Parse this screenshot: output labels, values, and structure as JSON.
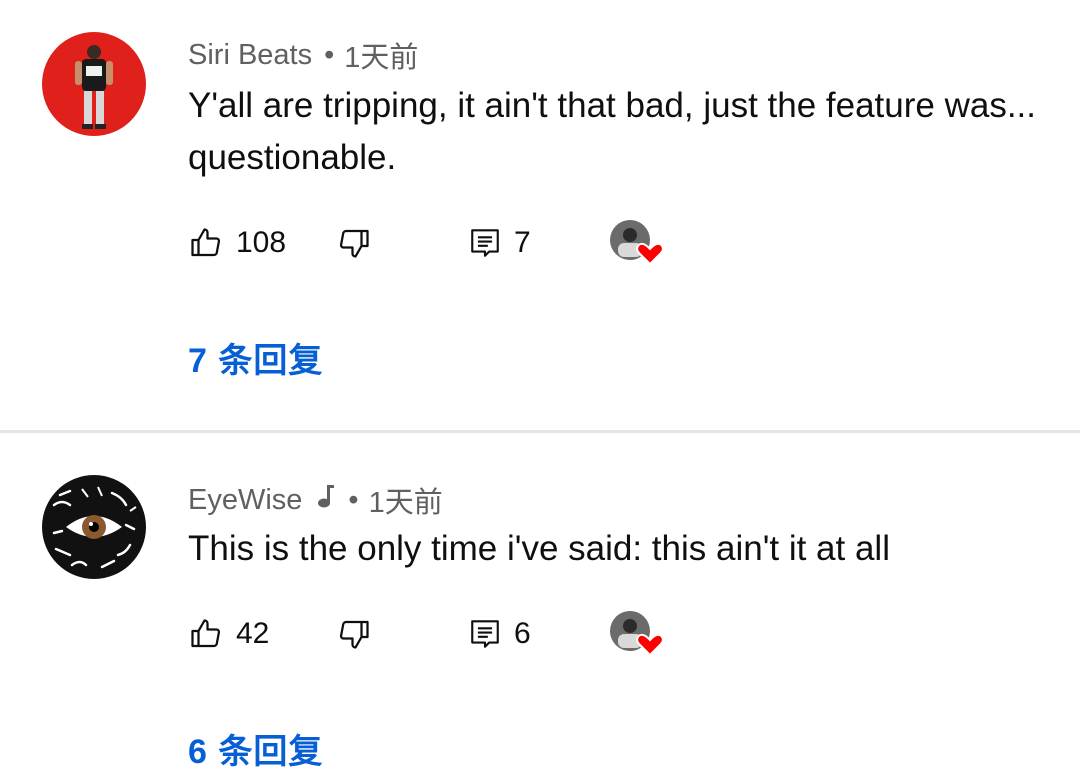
{
  "comments": [
    {
      "author": "Siri Beats",
      "separator": "•",
      "time": "1天前",
      "text": "Y'all are tripping, it ain't that bad, just the feature was... questionable.",
      "likes": "108",
      "replies_count": "7",
      "replies_link": "7 条回复",
      "avatar_icon": "person-on-red-avatar",
      "avatar_color": "#e0201a",
      "creator_hearted": true
    },
    {
      "author": "EyeWise",
      "author_badge_icon": "music-note-icon",
      "separator": "•",
      "time": "1天前",
      "text": "This is the only time i've said: this ain't it at all",
      "likes": "42",
      "replies_count": "6",
      "replies_link": "6 条回复",
      "avatar_icon": "eye-graffiti-avatar",
      "avatar_color": "#111111",
      "creator_hearted": true
    }
  ],
  "colors": {
    "link": "#065fd4",
    "meta_text": "#606060",
    "heart": "#ff0000",
    "divider": "#e5e5e5"
  }
}
